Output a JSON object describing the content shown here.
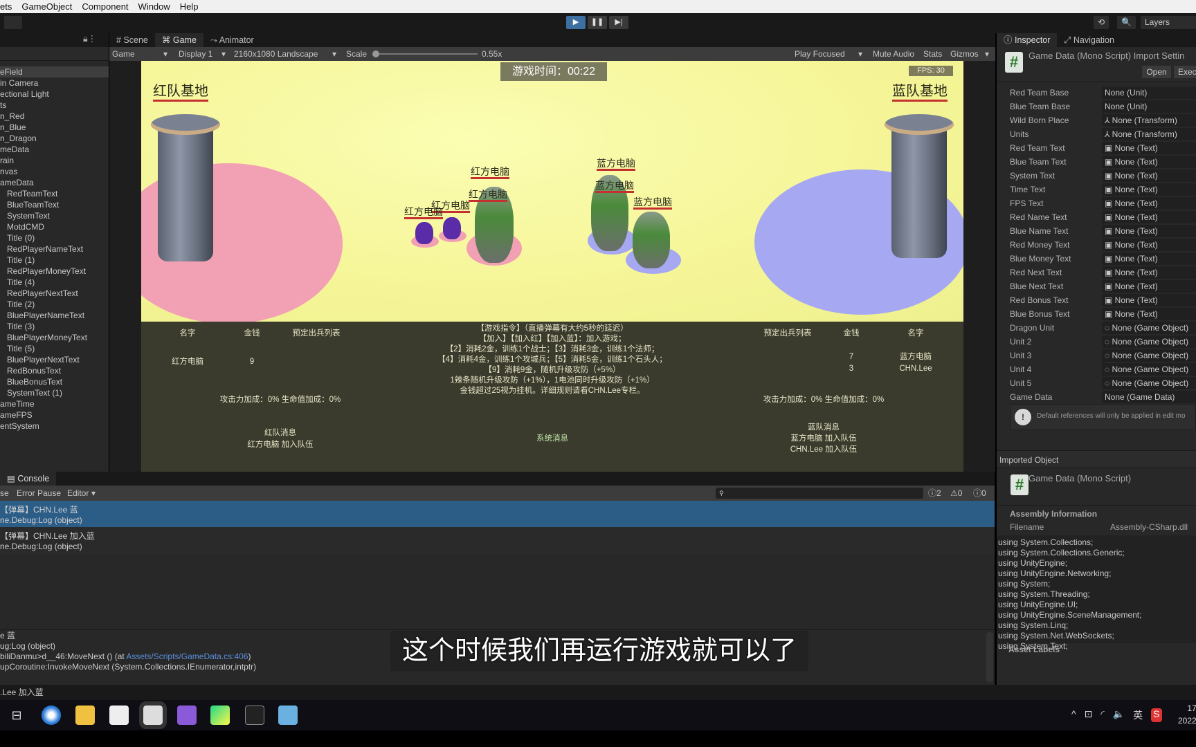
{
  "menu": [
    "ets",
    "GameObject",
    "Component",
    "Window",
    "Help"
  ],
  "toolbar": {
    "play": "▶",
    "pause": "❚❚",
    "step": "▶|",
    "history": "⟲",
    "search": "🔍",
    "layers": "Layers"
  },
  "hierarchy": {
    "items": [
      {
        "t": "eField",
        "d": 0
      },
      {
        "t": "in Camera",
        "d": 0
      },
      {
        "t": "ectional Light",
        "d": 0
      },
      {
        "t": "ts",
        "d": 0
      },
      {
        "t": "n_Red",
        "d": 0
      },
      {
        "t": "n_Blue",
        "d": 0
      },
      {
        "t": "n_Dragon",
        "d": 0
      },
      {
        "t": "meData",
        "d": 0
      },
      {
        "t": "rain",
        "d": 0
      },
      {
        "t": "nvas",
        "d": 0
      },
      {
        "t": "ameData",
        "d": 0
      },
      {
        "t": "RedTeamText",
        "d": 1
      },
      {
        "t": "BlueTeamText",
        "d": 1
      },
      {
        "t": "SystemText",
        "d": 1
      },
      {
        "t": "MotdCMD",
        "d": 1
      },
      {
        "t": "Title (0)",
        "d": 1
      },
      {
        "t": "RedPlayerNameText",
        "d": 1
      },
      {
        "t": "Title (1)",
        "d": 1
      },
      {
        "t": "RedPlayerMoneyText",
        "d": 1
      },
      {
        "t": "Title (4)",
        "d": 1
      },
      {
        "t": "RedPlayerNextText",
        "d": 1
      },
      {
        "t": "Title (2)",
        "d": 1
      },
      {
        "t": "BluePlayerNameText",
        "d": 1
      },
      {
        "t": "Title (3)",
        "d": 1
      },
      {
        "t": "BluePlayerMoneyText",
        "d": 1
      },
      {
        "t": "Title (5)",
        "d": 1
      },
      {
        "t": "BluePlayerNextText",
        "d": 1
      },
      {
        "t": "RedBonusText",
        "d": 1
      },
      {
        "t": "BlueBonusText",
        "d": 1
      },
      {
        "t": "SystemText (1)",
        "d": 1
      },
      {
        "t": "ameTime",
        "d": 0
      },
      {
        "t": "ameFPS",
        "d": 0
      },
      {
        "t": "entSystem",
        "d": 0
      }
    ]
  },
  "scene_tabs": {
    "scene": "# Scene",
    "game": "Game",
    "animator": "Animator"
  },
  "game_toolbar": {
    "mode": "Game",
    "display": "Display 1",
    "resolution": "2160x1080 Landscape",
    "scale_label": "Scale",
    "scale_value": "0.55x",
    "play_focused": "Play Focused",
    "mute": "Mute Audio",
    "stats": "Stats",
    "gizmos": "Gizmos"
  },
  "game": {
    "timer": "游戏时间：00:22",
    "fps": "FPS: 30",
    "red_base": "红队基地",
    "blue_base": "蓝队基地",
    "red_units": [
      "红方电脑",
      "红方电脑",
      "红方电脑",
      "红方电脑"
    ],
    "blue_units": [
      "蓝方电脑",
      "蓝方电脑",
      "蓝方电脑"
    ],
    "left_headers": [
      "名字",
      "金钱",
      "预定出兵列表"
    ],
    "right_headers": [
      "预定出兵列表",
      "金钱",
      "名字"
    ],
    "red_players": [
      {
        "name": "红方电脑",
        "money": "9"
      }
    ],
    "blue_players": [
      {
        "name": "蓝方电脑",
        "money": "7"
      },
      {
        "name": "CHN.Lee",
        "money": "3"
      }
    ],
    "instructions": [
      "【游戏指令】（直播弹幕有大约5秒的延迟）",
      "【加入】【加入红】【加入蓝】：加入游戏；",
      "【2】消耗2金，训练1个战士；【3】消耗3金，训练1个法师；",
      "【4】消耗4金，训练1个攻城兵；【5】消耗5金，训练1个石头人；",
      "【9】消耗9金，随机升级攻防（+5%）",
      "1辣条随机升级攻防（+1%），1电池同时升级攻防（+1%）",
      "金钱超过25视为挂机。详细规则请看CHN.Lee专栏。"
    ],
    "red_bonus": "攻击力加成：0%   生命值加成：0%",
    "blue_bonus": "攻击力加成：0%   生命值加成：0%",
    "red_msg_title": "红队消息",
    "red_msgs": [
      "红方电脑 加入队伍"
    ],
    "system_msg": "系统消息",
    "blue_msg_title": "蓝队消息",
    "blue_msgs": [
      "蓝方电脑 加入队伍",
      "CHN.Lee 加入队伍"
    ],
    "colors": {
      "field": "#f5f597",
      "red_base": "#f2a0b4",
      "blue_base": "#a6a8f2",
      "panel": "#3b3b2d"
    }
  },
  "inspector": {
    "tab": "Inspector",
    "nav_tab": "Navigation",
    "title": "Game Data (Mono Script) Import Settin",
    "open": "Open",
    "exec": "Exec",
    "fields": [
      [
        "Red Team Base",
        "None (Unit)"
      ],
      [
        "Blue Team Base",
        "None (Unit)"
      ],
      [
        "Wild Born Place",
        "⅄ None (Transform)"
      ],
      [
        "Units",
        "⅄ None (Transform)"
      ],
      [
        "Red Team Text",
        "▣ None (Text)"
      ],
      [
        "Blue Team Text",
        "▣ None (Text)"
      ],
      [
        "System Text",
        "▣ None (Text)"
      ],
      [
        "Time Text",
        "▣ None (Text)"
      ],
      [
        "FPS Text",
        "▣ None (Text)"
      ],
      [
        "Red Name Text",
        "▣ None (Text)"
      ],
      [
        "Blue Name Text",
        "▣ None (Text)"
      ],
      [
        "Red Money Text",
        "▣ None (Text)"
      ],
      [
        "Blue Money Text",
        "▣ None (Text)"
      ],
      [
        "Red Next Text",
        "▣ None (Text)"
      ],
      [
        "Blue Next Text",
        "▣ None (Text)"
      ],
      [
        "Red Bonus Text",
        "▣ None (Text)"
      ],
      [
        "Blue Bonus Text",
        "▣ None (Text)"
      ],
      [
        "Dragon Unit",
        "◌ None (Game Object)"
      ],
      [
        "Unit 2",
        "◌ None (Game Object)"
      ],
      [
        "Unit 3",
        "◌ None (Game Object)"
      ],
      [
        "Unit 4",
        "◌ None (Game Object)"
      ],
      [
        "Unit 5",
        "◌ None (Game Object)"
      ],
      [
        "Game Data",
        "None (Game Data)"
      ]
    ],
    "warning": "Default references will only be applied in edit mo",
    "imported_object": "Imported Object",
    "imported_title": "Game Data (Mono Script)",
    "assembly_info": "Assembly Information",
    "filename_label": "Filename",
    "filename": "Assembly-CSharp.dll",
    "code": [
      "using System.Collections;",
      "using System.Collections.Generic;",
      "using UnityEngine;",
      "using UnityEngine.Networking;",
      "using System;",
      "using System.Threading;",
      "using UnityEngine.UI;",
      "using UnityEngine.SceneManagement;",
      "using System.Linq;",
      "using System.Net.WebSockets;",
      "using System.Text;"
    ],
    "asset_labels": "Asset Labels"
  },
  "console": {
    "tab": "Console",
    "clear": "se",
    "error_pause": "Error Pause",
    "editor": "Editor",
    "search_placeholder": "",
    "counts": {
      "info": "2",
      "warn": "0",
      "error": "0"
    },
    "entries": [
      [
        "【弹幕】CHN.Lee 蓝",
        "ne.Debug:Log (object)"
      ],
      [
        "【弹幕】CHN.Lee 加入蓝",
        "ne.Debug:Log (object)"
      ]
    ],
    "detail": [
      "e 蓝",
      "ug:Log (object)"
    ],
    "detail_stack_pre": "biliDanmu>d__46:MoveNext () (at ",
    "detail_link": "Assets/Scripts/GameData.cs:406",
    "detail_stack_post": ")",
    "detail_last": "upCoroutine:InvokeMoveNext (System.Collections.IEnumerator,intptr)"
  },
  "status": ".Lee 加入蓝",
  "subtitle": "这个时候我们再运行游戏就可以了",
  "taskbar": {
    "icons": [
      "task-view-icon",
      "browser-icon",
      "file-explorer-icon",
      "unity-hub-icon",
      "unity-editor-icon",
      "visual-studio-icon",
      "pycharm-icon",
      "terminal-icon",
      "app-icon"
    ],
    "tray": [
      "^",
      "⊡",
      "◜",
      "🔈",
      "英"
    ],
    "clock_time": "17",
    "clock_date": "2022"
  }
}
